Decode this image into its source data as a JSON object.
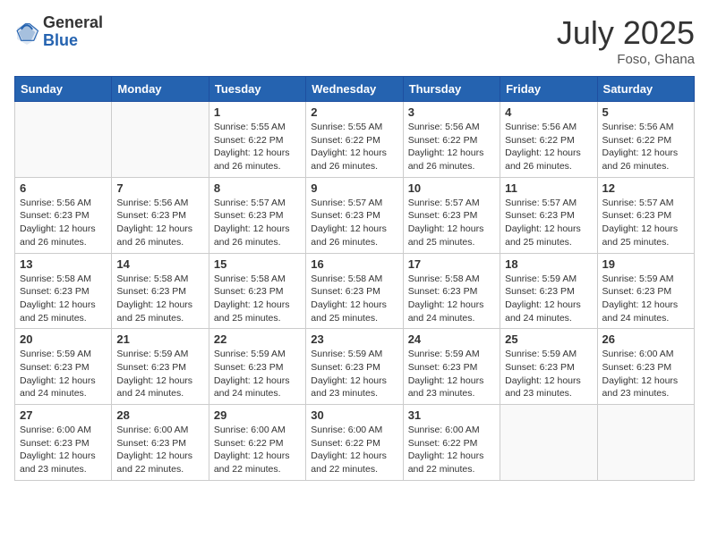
{
  "header": {
    "logo_general": "General",
    "logo_blue": "Blue",
    "month_title": "July 2025",
    "location": "Foso, Ghana"
  },
  "weekdays": [
    "Sunday",
    "Monday",
    "Tuesday",
    "Wednesday",
    "Thursday",
    "Friday",
    "Saturday"
  ],
  "weeks": [
    [
      {
        "day": "",
        "info": ""
      },
      {
        "day": "",
        "info": ""
      },
      {
        "day": "1",
        "info": "Sunrise: 5:55 AM\nSunset: 6:22 PM\nDaylight: 12 hours and 26 minutes."
      },
      {
        "day": "2",
        "info": "Sunrise: 5:55 AM\nSunset: 6:22 PM\nDaylight: 12 hours and 26 minutes."
      },
      {
        "day": "3",
        "info": "Sunrise: 5:56 AM\nSunset: 6:22 PM\nDaylight: 12 hours and 26 minutes."
      },
      {
        "day": "4",
        "info": "Sunrise: 5:56 AM\nSunset: 6:22 PM\nDaylight: 12 hours and 26 minutes."
      },
      {
        "day": "5",
        "info": "Sunrise: 5:56 AM\nSunset: 6:22 PM\nDaylight: 12 hours and 26 minutes."
      }
    ],
    [
      {
        "day": "6",
        "info": "Sunrise: 5:56 AM\nSunset: 6:23 PM\nDaylight: 12 hours and 26 minutes."
      },
      {
        "day": "7",
        "info": "Sunrise: 5:56 AM\nSunset: 6:23 PM\nDaylight: 12 hours and 26 minutes."
      },
      {
        "day": "8",
        "info": "Sunrise: 5:57 AM\nSunset: 6:23 PM\nDaylight: 12 hours and 26 minutes."
      },
      {
        "day": "9",
        "info": "Sunrise: 5:57 AM\nSunset: 6:23 PM\nDaylight: 12 hours and 26 minutes."
      },
      {
        "day": "10",
        "info": "Sunrise: 5:57 AM\nSunset: 6:23 PM\nDaylight: 12 hours and 25 minutes."
      },
      {
        "day": "11",
        "info": "Sunrise: 5:57 AM\nSunset: 6:23 PM\nDaylight: 12 hours and 25 minutes."
      },
      {
        "day": "12",
        "info": "Sunrise: 5:57 AM\nSunset: 6:23 PM\nDaylight: 12 hours and 25 minutes."
      }
    ],
    [
      {
        "day": "13",
        "info": "Sunrise: 5:58 AM\nSunset: 6:23 PM\nDaylight: 12 hours and 25 minutes."
      },
      {
        "day": "14",
        "info": "Sunrise: 5:58 AM\nSunset: 6:23 PM\nDaylight: 12 hours and 25 minutes."
      },
      {
        "day": "15",
        "info": "Sunrise: 5:58 AM\nSunset: 6:23 PM\nDaylight: 12 hours and 25 minutes."
      },
      {
        "day": "16",
        "info": "Sunrise: 5:58 AM\nSunset: 6:23 PM\nDaylight: 12 hours and 25 minutes."
      },
      {
        "day": "17",
        "info": "Sunrise: 5:58 AM\nSunset: 6:23 PM\nDaylight: 12 hours and 24 minutes."
      },
      {
        "day": "18",
        "info": "Sunrise: 5:59 AM\nSunset: 6:23 PM\nDaylight: 12 hours and 24 minutes."
      },
      {
        "day": "19",
        "info": "Sunrise: 5:59 AM\nSunset: 6:23 PM\nDaylight: 12 hours and 24 minutes."
      }
    ],
    [
      {
        "day": "20",
        "info": "Sunrise: 5:59 AM\nSunset: 6:23 PM\nDaylight: 12 hours and 24 minutes."
      },
      {
        "day": "21",
        "info": "Sunrise: 5:59 AM\nSunset: 6:23 PM\nDaylight: 12 hours and 24 minutes."
      },
      {
        "day": "22",
        "info": "Sunrise: 5:59 AM\nSunset: 6:23 PM\nDaylight: 12 hours and 24 minutes."
      },
      {
        "day": "23",
        "info": "Sunrise: 5:59 AM\nSunset: 6:23 PM\nDaylight: 12 hours and 23 minutes."
      },
      {
        "day": "24",
        "info": "Sunrise: 5:59 AM\nSunset: 6:23 PM\nDaylight: 12 hours and 23 minutes."
      },
      {
        "day": "25",
        "info": "Sunrise: 5:59 AM\nSunset: 6:23 PM\nDaylight: 12 hours and 23 minutes."
      },
      {
        "day": "26",
        "info": "Sunrise: 6:00 AM\nSunset: 6:23 PM\nDaylight: 12 hours and 23 minutes."
      }
    ],
    [
      {
        "day": "27",
        "info": "Sunrise: 6:00 AM\nSunset: 6:23 PM\nDaylight: 12 hours and 23 minutes."
      },
      {
        "day": "28",
        "info": "Sunrise: 6:00 AM\nSunset: 6:23 PM\nDaylight: 12 hours and 22 minutes."
      },
      {
        "day": "29",
        "info": "Sunrise: 6:00 AM\nSunset: 6:22 PM\nDaylight: 12 hours and 22 minutes."
      },
      {
        "day": "30",
        "info": "Sunrise: 6:00 AM\nSunset: 6:22 PM\nDaylight: 12 hours and 22 minutes."
      },
      {
        "day": "31",
        "info": "Sunrise: 6:00 AM\nSunset: 6:22 PM\nDaylight: 12 hours and 22 minutes."
      },
      {
        "day": "",
        "info": ""
      },
      {
        "day": "",
        "info": ""
      }
    ]
  ]
}
